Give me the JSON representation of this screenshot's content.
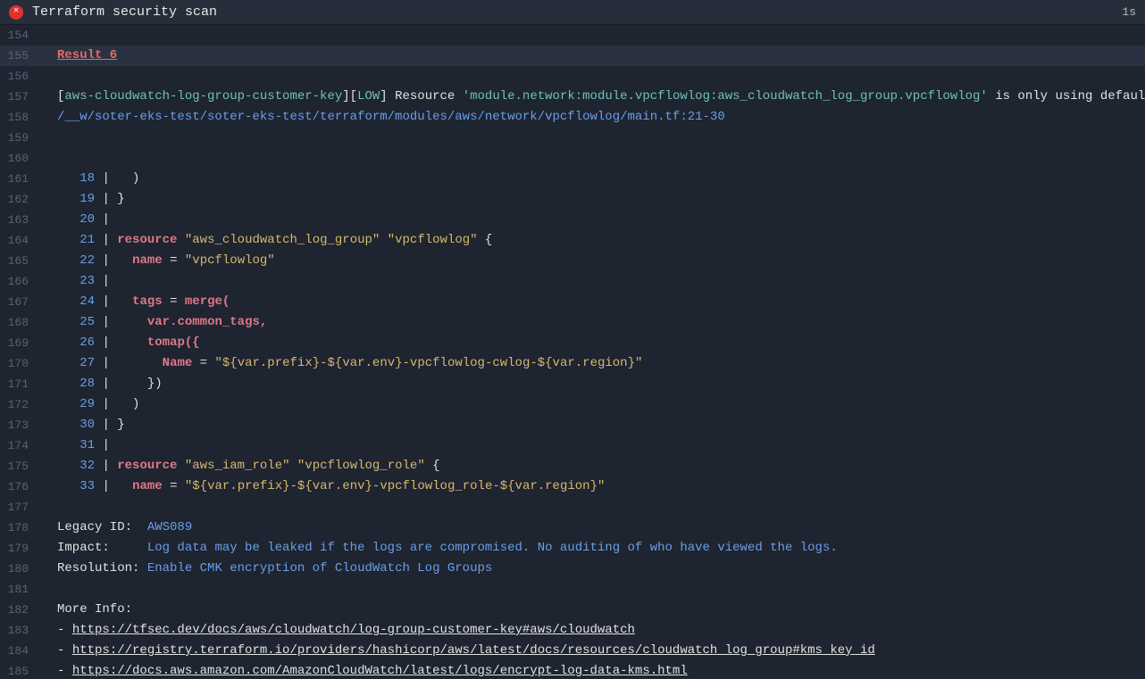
{
  "header": {
    "title": "Terraform security scan",
    "time": "1s",
    "icon": "error-circle-icon"
  },
  "gutter_start": 154,
  "result": {
    "label": "Result 6"
  },
  "finding": {
    "rule_id": "aws-cloudwatch-log-group-customer-key",
    "severity": "LOW",
    "message_prefix": " Resource ",
    "resource": "'module.network:module.vpcflowlog:aws_cloudwatch_log_group.vpcflowlog'",
    "message_suffix": " is only using default encryption",
    "file_path": "/__w/soter-eks-test/soter-eks-test/terraform/modules/aws/network/vpcflowlog/main.tf:21-30"
  },
  "code": [
    {
      "n": "18",
      "body": "  )"
    },
    {
      "n": "19",
      "body": "}"
    },
    {
      "n": "20",
      "body": ""
    },
    {
      "n": "21",
      "kind": "res",
      "kw": "resource ",
      "name": "\"aws_cloudwatch_log_group\" \"vpcflowlog\"",
      "tail": " {"
    },
    {
      "n": "22",
      "kind": "attr",
      "indent": "  ",
      "key": "name",
      "eq": " = ",
      "val": "\"vpcflowlog\""
    },
    {
      "n": "23",
      "body": ""
    },
    {
      "n": "24",
      "kind": "attr",
      "indent": "  ",
      "key": "tags",
      "eq": " = ",
      "valraw": "merge("
    },
    {
      "n": "25",
      "kind": "raw",
      "indent": "    ",
      "raw": "var.common_tags,"
    },
    {
      "n": "26",
      "kind": "raw",
      "indent": "    ",
      "raw": "tomap({"
    },
    {
      "n": "27",
      "kind": "attr",
      "indent": "      ",
      "key": "Name",
      "eq": " = ",
      "val": "\"${var.prefix}-${var.env}-vpcflowlog-cwlog-${var.region}\""
    },
    {
      "n": "28",
      "body": "    })"
    },
    {
      "n": "29",
      "body": "  )"
    },
    {
      "n": "30",
      "body": "}"
    },
    {
      "n": "31",
      "body": ""
    },
    {
      "n": "32",
      "kind": "res",
      "kw": "resource ",
      "name": "\"aws_iam_role\" \"vpcflowlog_role\"",
      "tail": " {"
    },
    {
      "n": "33",
      "kind": "attr",
      "indent": "  ",
      "key": "name",
      "eq": " = ",
      "val": "\"${var.prefix}-${var.env}-vpcflowlog_role-${var.region}\""
    }
  ],
  "details": {
    "legacy_label": "Legacy ID:  ",
    "legacy_id": "AWS089",
    "impact_label": "Impact:     ",
    "impact": "Log data may be leaked if the logs are compromised. No auditing of who have viewed the logs.",
    "resolution_label": "Resolution: ",
    "resolution": "Enable CMK encryption of CloudWatch Log Groups",
    "more_info_label": "More Info:",
    "links": [
      "https://tfsec.dev/docs/aws/cloudwatch/log-group-customer-key#aws/cloudwatch",
      "https://registry.terraform.io/providers/hashicorp/aws/latest/docs/resources/cloudwatch_log_group#kms_key_id",
      "https://docs.aws.amazon.com/AmazonCloudWatch/latest/logs/encrypt-log-data-kms.html"
    ]
  }
}
